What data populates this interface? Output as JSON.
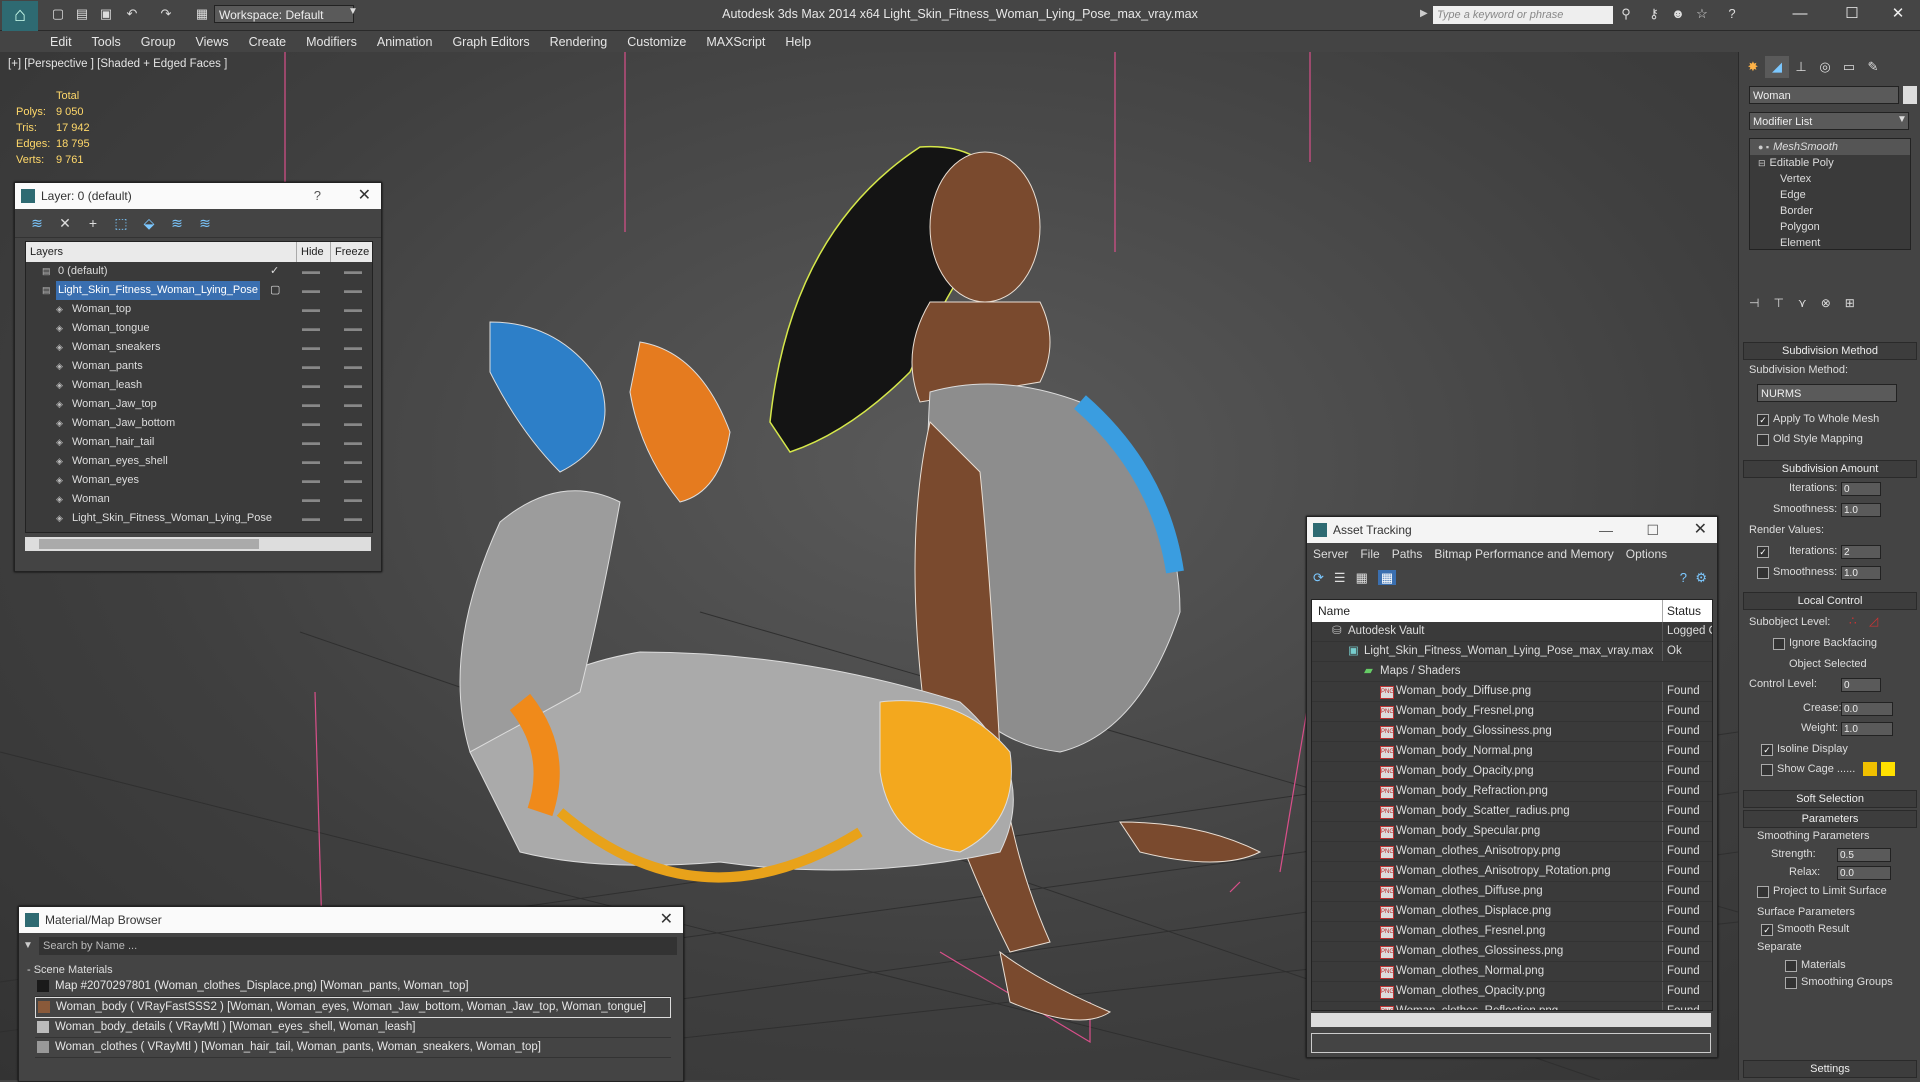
{
  "app": {
    "title": "Autodesk 3ds Max  2014 x64     Light_Skin_Fitness_Woman_Lying_Pose_max_vray.max",
    "workspace": "Workspace: Default",
    "search_placeholder": "Type a keyword or phrase"
  },
  "menu": [
    "Edit",
    "Tools",
    "Group",
    "Views",
    "Create",
    "Modifiers",
    "Animation",
    "Graph Editors",
    "Rendering",
    "Customize",
    "MAXScript",
    "Help"
  ],
  "viewport": {
    "label": "[+] [Perspective ] [Shaded + Edged Faces ]",
    "stats": {
      "header": "Total",
      "rows": [
        {
          "label": "Polys:",
          "value": "9 050"
        },
        {
          "label": "Tris:",
          "value": "17 942"
        },
        {
          "label": "Edges:",
          "value": "18 795"
        },
        {
          "label": "Verts:",
          "value": "9 761"
        }
      ]
    }
  },
  "layer_panel": {
    "title": "Layer: 0 (default)",
    "help": "?",
    "columns": {
      "layers": "Layers",
      "hide": "Hide",
      "freeze": "Freeze"
    },
    "rows": [
      {
        "name": "0 (default)",
        "indent": 1,
        "selected": false,
        "checked": true
      },
      {
        "name": "Light_Skin_Fitness_Woman_Lying_Pose",
        "indent": 1,
        "selected": true,
        "checked": false
      },
      {
        "name": "Woman_top",
        "indent": 2,
        "selected": false,
        "checked": false
      },
      {
        "name": "Woman_tongue",
        "indent": 2,
        "selected": false,
        "checked": false
      },
      {
        "name": "Woman_sneakers",
        "indent": 2,
        "selected": false,
        "checked": false
      },
      {
        "name": "Woman_pants",
        "indent": 2,
        "selected": false,
        "checked": false
      },
      {
        "name": "Woman_leash",
        "indent": 2,
        "selected": false,
        "checked": false
      },
      {
        "name": "Woman_Jaw_top",
        "indent": 2,
        "selected": false,
        "checked": false
      },
      {
        "name": "Woman_Jaw_bottom",
        "indent": 2,
        "selected": false,
        "checked": false
      },
      {
        "name": "Woman_hair_tail",
        "indent": 2,
        "selected": false,
        "checked": false
      },
      {
        "name": "Woman_eyes_shell",
        "indent": 2,
        "selected": false,
        "checked": false
      },
      {
        "name": "Woman_eyes",
        "indent": 2,
        "selected": false,
        "checked": false
      },
      {
        "name": "Woman",
        "indent": 2,
        "selected": false,
        "checked": false
      },
      {
        "name": "Light_Skin_Fitness_Woman_Lying_Pose",
        "indent": 2,
        "selected": false,
        "checked": false
      }
    ]
  },
  "material_browser": {
    "title": "Material/Map Browser",
    "search_placeholder": "Search by Name ...",
    "group": "- Scene Materials",
    "rows": [
      {
        "text": "Map #2070297801 (Woman_clothes_Displace.png) [Woman_pants, Woman_top]",
        "swatch": "#1a1a1a",
        "selected": false
      },
      {
        "text": "Woman_body  ( VRayFastSSS2 ) [Woman, Woman_eyes, Woman_Jaw_bottom, Woman_Jaw_top, Woman_tongue]",
        "swatch": "#8a5a3a",
        "selected": true
      },
      {
        "text": "Woman_body_details  ( VRayMtl ) [Woman_eyes_shell, Woman_leash]",
        "swatch": "#bbbbbb",
        "selected": false
      },
      {
        "text": "Woman_clothes  ( VRayMtl ) [Woman_hair_tail, Woman_pants, Woman_sneakers, Woman_top]",
        "swatch": "#999999",
        "selected": false
      }
    ]
  },
  "asset_tracking": {
    "title": "Asset Tracking",
    "menu": [
      "Server",
      "File",
      "Paths",
      "Bitmap Performance and Memory",
      "Options"
    ],
    "columns": {
      "name": "Name",
      "status": "Status"
    },
    "rows": [
      {
        "name": "Autodesk Vault",
        "status": "Logged O",
        "indent": 0,
        "kind": "vault"
      },
      {
        "name": "Light_Skin_Fitness_Woman_Lying_Pose_max_vray.max",
        "status": "Ok",
        "indent": 1,
        "kind": "max"
      },
      {
        "name": "Maps / Shaders",
        "status": "",
        "indent": 2,
        "kind": "folder"
      },
      {
        "name": "Woman_body_Diffuse.png",
        "status": "Found",
        "indent": 3,
        "kind": "png"
      },
      {
        "name": "Woman_body_Fresnel.png",
        "status": "Found",
        "indent": 3,
        "kind": "png"
      },
      {
        "name": "Woman_body_Glossiness.png",
        "status": "Found",
        "indent": 3,
        "kind": "png"
      },
      {
        "name": "Woman_body_Normal.png",
        "status": "Found",
        "indent": 3,
        "kind": "png"
      },
      {
        "name": "Woman_body_Opacity.png",
        "status": "Found",
        "indent": 3,
        "kind": "png"
      },
      {
        "name": "Woman_body_Refraction.png",
        "status": "Found",
        "indent": 3,
        "kind": "png"
      },
      {
        "name": "Woman_body_Scatter_radius.png",
        "status": "Found",
        "indent": 3,
        "kind": "png"
      },
      {
        "name": "Woman_body_Specular.png",
        "status": "Found",
        "indent": 3,
        "kind": "png"
      },
      {
        "name": "Woman_clothes_Anisotropy.png",
        "status": "Found",
        "indent": 3,
        "kind": "png"
      },
      {
        "name": "Woman_clothes_Anisotropy_Rotation.png",
        "status": "Found",
        "indent": 3,
        "kind": "png"
      },
      {
        "name": "Woman_clothes_Diffuse.png",
        "status": "Found",
        "indent": 3,
        "kind": "png"
      },
      {
        "name": "Woman_clothes_Displace.png",
        "status": "Found",
        "indent": 3,
        "kind": "png"
      },
      {
        "name": "Woman_clothes_Fresnel.png",
        "status": "Found",
        "indent": 3,
        "kind": "png"
      },
      {
        "name": "Woman_clothes_Glossiness.png",
        "status": "Found",
        "indent": 3,
        "kind": "png"
      },
      {
        "name": "Woman_clothes_Normal.png",
        "status": "Found",
        "indent": 3,
        "kind": "png"
      },
      {
        "name": "Woman_clothes_Opacity.png",
        "status": "Found",
        "indent": 3,
        "kind": "png"
      },
      {
        "name": "Woman_clothes_Reflection.png",
        "status": "Found",
        "indent": 3,
        "kind": "png"
      }
    ]
  },
  "command_panel": {
    "object_name": "Woman",
    "modifier_list": "Modifier List",
    "stack": [
      {
        "name": "MeshSmooth",
        "level": 0,
        "italic": true
      },
      {
        "name": "Editable Poly",
        "level": 0,
        "italic": false
      },
      {
        "name": "Vertex",
        "level": 1,
        "italic": false
      },
      {
        "name": "Edge",
        "level": 1,
        "italic": false
      },
      {
        "name": "Border",
        "level": 1,
        "italic": false
      },
      {
        "name": "Polygon",
        "level": 1,
        "italic": false
      },
      {
        "name": "Element",
        "level": 1,
        "italic": false
      }
    ],
    "subdivision_method": {
      "title": "Subdivision Method",
      "label": "Subdivision Method:",
      "value": "NURMS",
      "apply_whole": "Apply To Whole Mesh",
      "apply_whole_checked": true,
      "old_style": "Old Style Mapping",
      "old_style_checked": false
    },
    "subdivision_amount": {
      "title": "Subdivision Amount",
      "iterations_label": "Iterations:",
      "iterations": "0",
      "smoothness_label": "Smoothness:",
      "smoothness": "1.0",
      "render_values": "Render Values:",
      "render_iterations_label": "Iterations:",
      "render_iterations": "2",
      "render_smoothness_label": "Smoothness:",
      "render_smoothness": "1.0"
    },
    "local_control": {
      "title": "Local Control",
      "subobject_label": "Subobject Level:",
      "ignore_backfacing": "Ignore Backfacing",
      "object_selected": "Object Selected",
      "control_level_label": "Control Level:",
      "control_level": "0",
      "crease_label": "Crease:",
      "crease": "0.0",
      "weight_label": "Weight:",
      "weight": "1.0",
      "isoline": "Isoline Display",
      "show_cage": "Show Cage ......",
      "cage_color_1": "#f0c000",
      "cage_color_2": "#ffe000"
    },
    "soft_selection": "Soft Selection",
    "parameters": {
      "title": "Parameters",
      "smoothing_params": "Smoothing Parameters",
      "strength_label": "Strength:",
      "strength": "0.5",
      "relax_label": "Relax:",
      "relax": "0.0",
      "project_limit": "Project to Limit Surface",
      "surface_params": "Surface Parameters",
      "smooth_result": "Smooth Result",
      "separate": "Separate",
      "materials": "Materials",
      "smoothing_groups": "Smoothing Groups"
    },
    "settings": "Settings"
  },
  "colors": {
    "accent": "#3a6fb0",
    "viewport_bg": "#444444",
    "stats_text": "#ffd86a",
    "pink_bbox": "#d94f8a"
  }
}
